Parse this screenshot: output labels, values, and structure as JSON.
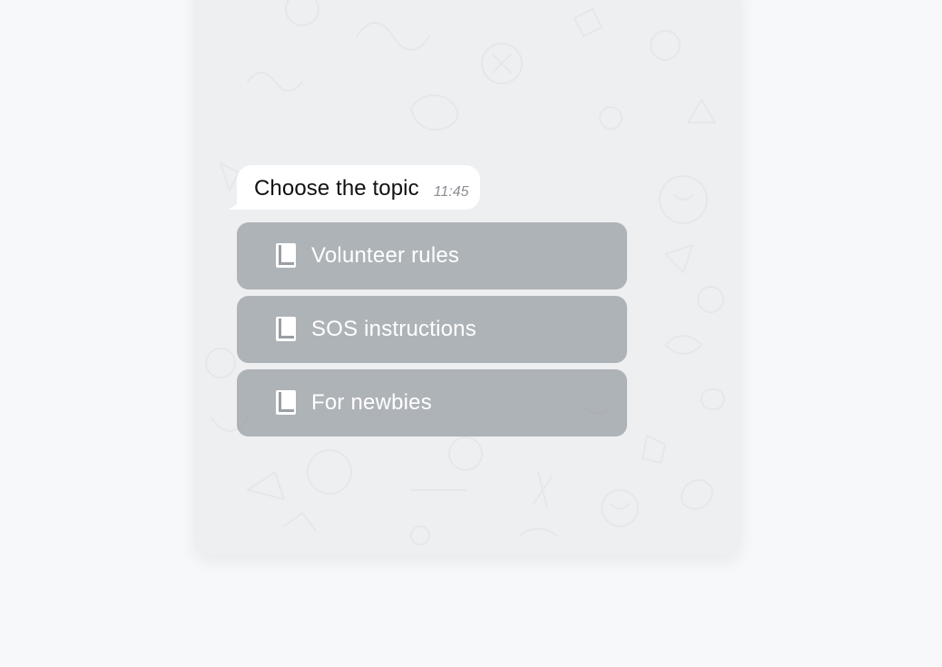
{
  "chat": {
    "message": {
      "text": "Choose the topic",
      "time": "11:45"
    },
    "keyboard": {
      "buttons": [
        {
          "label": "Volunteer rules",
          "icon": "book-icon"
        },
        {
          "label": "SOS instructions",
          "icon": "book-icon"
        },
        {
          "label": "For newbies",
          "icon": "book-icon"
        }
      ]
    }
  },
  "colors": {
    "page_background": "#f7f8fa",
    "chat_background": "#eeeff0",
    "bubble_background": "#ffffff",
    "button_background": "#9a9ea5",
    "button_text": "#ffffff"
  }
}
